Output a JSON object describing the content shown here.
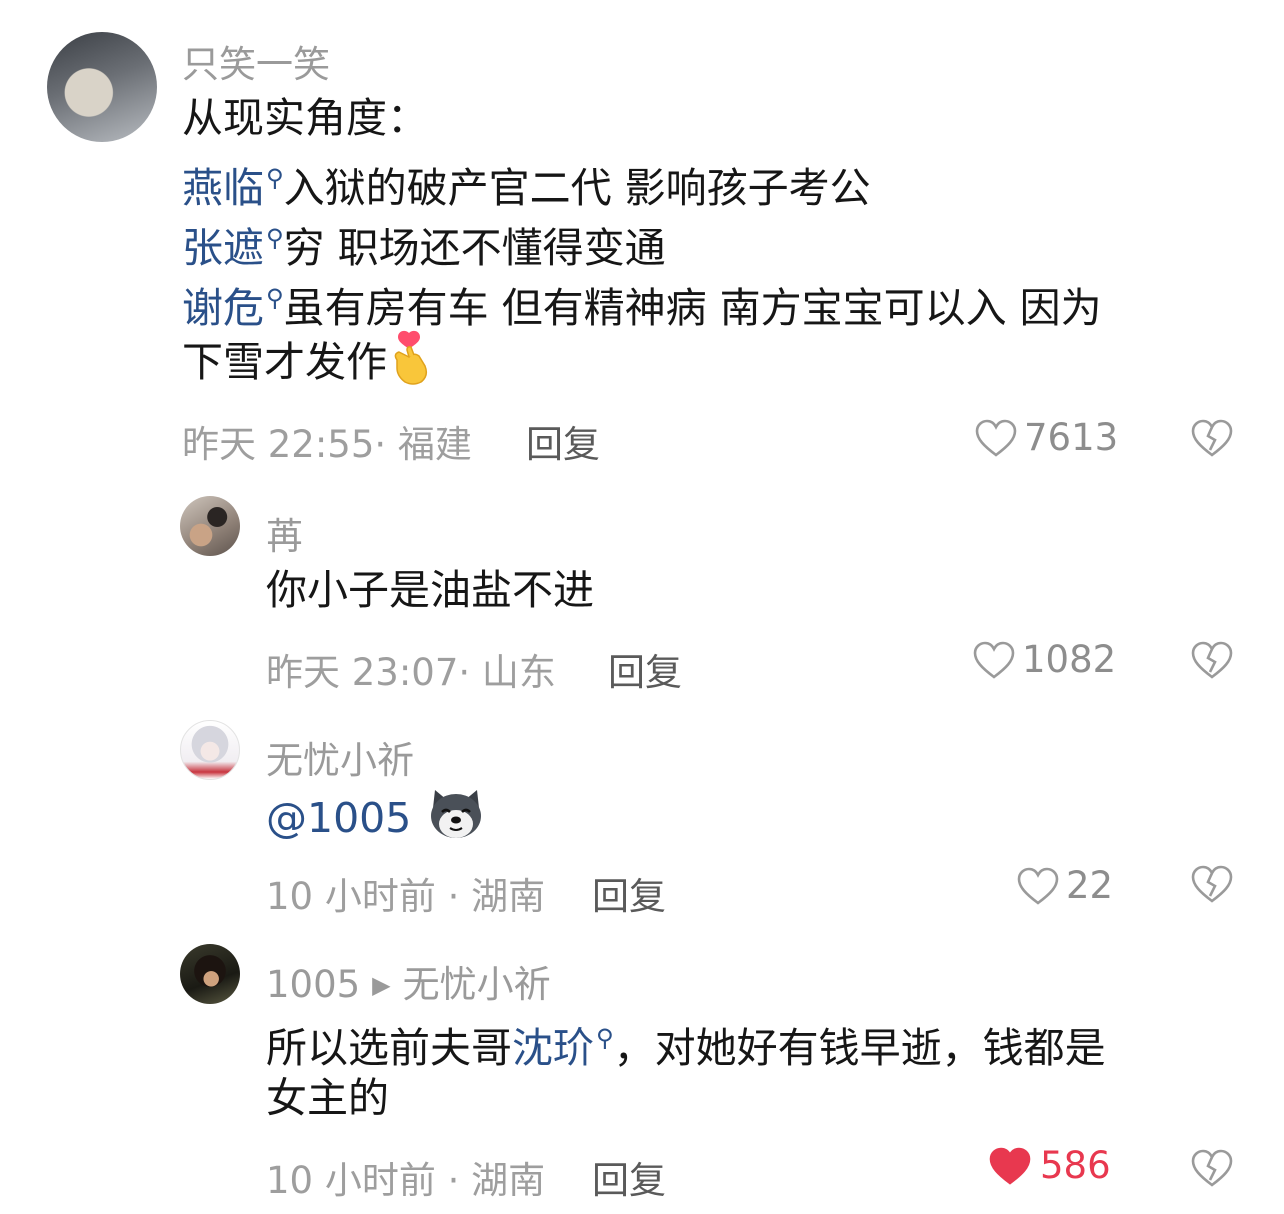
{
  "comments": [
    {
      "username": "只笑一笑",
      "lines": {
        "l1": "从现实角度：",
        "l2_link": "燕临",
        "l2_text": "入狱的破产官二代 影响孩子考公",
        "l3_link": "张遮",
        "l3_text": "穷 职场还不懂得变通",
        "l4_link": "谢危",
        "l4_text": "虽有房有车 但有精神病 南方宝宝可以入 因为",
        "l5_text": "下雪才发作"
      },
      "time": "昨天 22:55",
      "location": "福建",
      "reply_label": "回复",
      "likes": "7613"
    },
    {
      "username": "苒",
      "text": "你小子是油盐不进",
      "time": "昨天 23:07",
      "location": "山东",
      "reply_label": "回复",
      "likes": "1082"
    },
    {
      "username": "无忧小祈",
      "mention": "@1005",
      "time": "10 小时前",
      "location": "湖南",
      "reply_label": "回复",
      "likes": "22"
    },
    {
      "username": "1005",
      "reply_to": "无忧小祈",
      "text_a": "所以选前夫哥",
      "link": "沈玠",
      "text_b": "，对她好有钱早逝，钱都是",
      "text_c": "女主的",
      "time": "10 小时前",
      "location": "湖南",
      "reply_label": "回复",
      "likes": "586",
      "liked": true
    }
  ],
  "colors": {
    "link": "#2a5089",
    "liked": "#e8384f",
    "meta": "#9e9e9e"
  }
}
